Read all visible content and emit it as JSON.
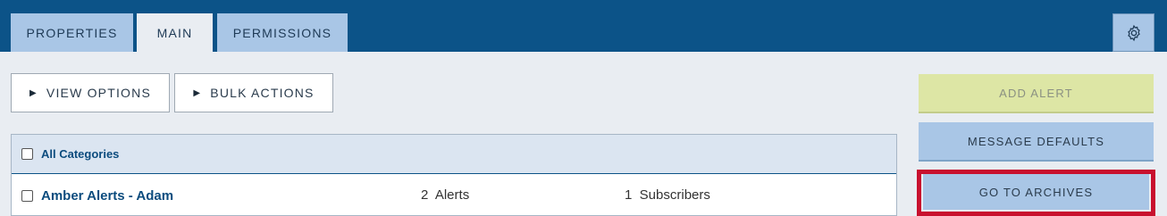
{
  "tabs": [
    {
      "label": "PROPERTIES",
      "active": false
    },
    {
      "label": "MAIN",
      "active": true
    },
    {
      "label": "PERMISSIONS",
      "active": false
    }
  ],
  "toolbar": {
    "view_options": "VIEW OPTIONS",
    "bulk_actions": "BULK ACTIONS"
  },
  "table": {
    "header_label": "All Categories",
    "rows": [
      {
        "name": "Amber Alerts - Adam",
        "alerts": "2  Alerts",
        "subscribers": "1  Subscribers"
      }
    ]
  },
  "side": {
    "add_alert": "ADD ALERT",
    "message_defaults": "MESSAGE DEFAULTS",
    "go_to_archives": "GO TO ARCHIVES"
  },
  "colors": {
    "topbar": "#0c5388",
    "tab": "#a9c6e6",
    "highlight": "#c8102e",
    "add_alert": "#dde6a5"
  },
  "icons": {
    "settings": "gear-icon",
    "expand": "triangle-right-icon"
  }
}
